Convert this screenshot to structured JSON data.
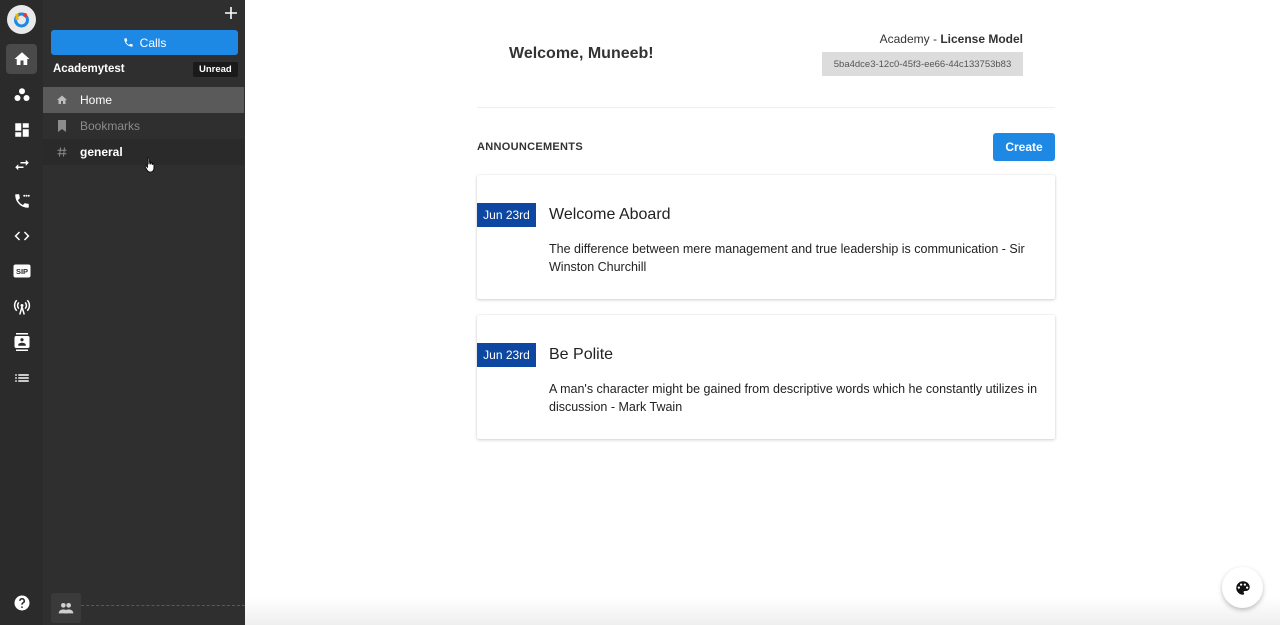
{
  "sidebar": {
    "calls_label": "Calls",
    "workspace_name": "Academytest",
    "unread_label": "Unread",
    "items": [
      {
        "label": "Home",
        "icon": "home-icon"
      },
      {
        "label": "Bookmarks",
        "icon": "bookmark-icon"
      },
      {
        "label": "general",
        "icon": "hash-icon"
      }
    ]
  },
  "rail": {
    "icons": [
      "home-icon",
      "users-icon",
      "dashboard-icon",
      "transfer-icon",
      "phone-forward-icon",
      "code-icon",
      "sip-icon",
      "antenna-icon",
      "contacts-icon",
      "list-icon",
      "help-icon"
    ],
    "sip_label": "SIP"
  },
  "header": {
    "welcome": "Welcome, Muneeb!",
    "license_prefix": "Academy - ",
    "license_model": "License Model",
    "license_id": "5ba4dce3-12c0-45f3-ee66-44c133753b83"
  },
  "announcements": {
    "title": "ANNOUNCEMENTS",
    "create_label": "Create",
    "items": [
      {
        "date": "Jun 23rd",
        "title": "Welcome Aboard",
        "body": "The difference between mere management and true leadership is communication - Sir Winston Churchill"
      },
      {
        "date": "Jun 23rd",
        "title": "Be Polite",
        "body": "A man's character might be gained from descriptive words which he constantly utilizes in discussion - Mark Twain"
      }
    ]
  },
  "colors": {
    "accent": "#1e88e5",
    "date_badge": "#0d47a1",
    "sidebar_bg": "#2f2f2f",
    "rail_bg": "#2b2b2b"
  }
}
